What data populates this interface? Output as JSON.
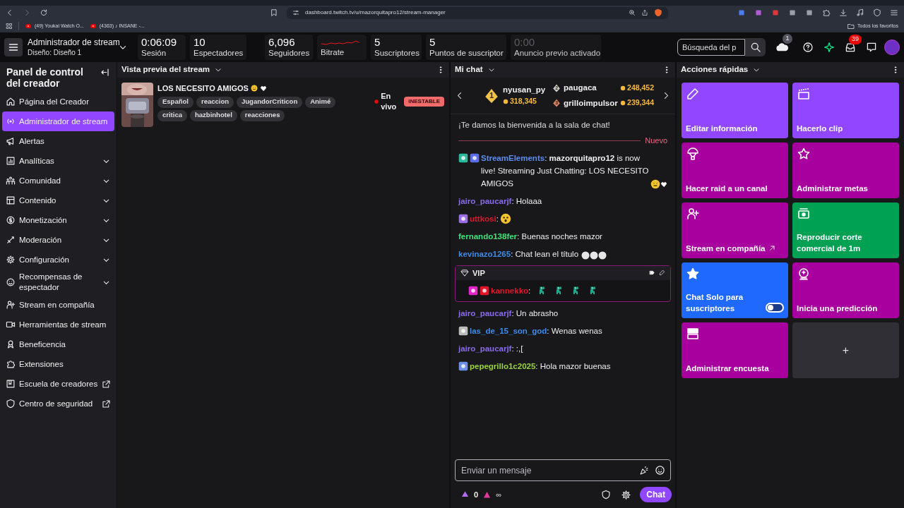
{
  "browser": {
    "url": "dashboard.twitch.tv/u/mazorquitapro12/stream-manager",
    "bookmarks": [
      "(49) Youkai Watch O...",
      "(4363) ♪ INSANE -..."
    ],
    "favorites": "Todos los favoritos"
  },
  "nav": {
    "title": "Administrador de stream",
    "subtitle": "Diseño: Diseño 1",
    "stats": [
      {
        "kind": "value",
        "value": "0:06:09",
        "label": "Sesión",
        "disabled": false
      },
      {
        "kind": "value",
        "value": "10",
        "label": "Espectadores",
        "disabled": false
      },
      {
        "kind": "value",
        "value": "6,096",
        "label": "Seguidores",
        "disabled": false
      },
      {
        "kind": "sparkline",
        "label": "Bitrate",
        "disabled": false
      },
      {
        "kind": "value",
        "value": "5",
        "label": "Suscriptores",
        "disabled": false
      },
      {
        "kind": "value",
        "value": "5",
        "label": "Puntos de suscriptor",
        "disabled": false
      },
      {
        "kind": "value",
        "value": "0:00",
        "label": "Anuncio previo activado",
        "disabled": true
      }
    ],
    "search_placeholder": "Búsqueda del p",
    "notifications_count": "1",
    "inbox_count": "39"
  },
  "sidebar": {
    "title": "Panel de control del creador",
    "items": [
      {
        "label": "Página del Creador",
        "selected": false,
        "has_submenu": false,
        "external": false
      },
      {
        "label": "Administrador de stream",
        "selected": true,
        "has_submenu": false,
        "external": false
      },
      {
        "label": "Alertas",
        "selected": false,
        "has_submenu": false,
        "external": false
      },
      {
        "label": "Analíticas",
        "selected": false,
        "has_submenu": true,
        "external": false
      },
      {
        "label": "Comunidad",
        "selected": false,
        "has_submenu": true,
        "external": false
      },
      {
        "label": "Contenido",
        "selected": false,
        "has_submenu": true,
        "external": false
      },
      {
        "label": "Monetización",
        "selected": false,
        "has_submenu": true,
        "external": false
      },
      {
        "label": "Moderación",
        "selected": false,
        "has_submenu": true,
        "external": false
      },
      {
        "label": "Configuración",
        "selected": false,
        "has_submenu": true,
        "external": false
      },
      {
        "label": "Recompensas de espectador",
        "selected": false,
        "has_submenu": true,
        "external": false
      },
      {
        "label": "Stream en compañía",
        "selected": false,
        "has_submenu": false,
        "external": false
      },
      {
        "label": "Herramientas de stream",
        "selected": false,
        "has_submenu": false,
        "external": false
      },
      {
        "label": "Beneficencia",
        "selected": false,
        "has_submenu": false,
        "external": false
      },
      {
        "label": "Extensiones",
        "selected": false,
        "has_submenu": false,
        "external": false
      },
      {
        "label": "Escuela de creadores",
        "selected": false,
        "has_submenu": false,
        "external": true
      },
      {
        "label": "Centro de seguridad",
        "selected": false,
        "has_submenu": false,
        "external": true
      }
    ]
  },
  "preview": {
    "header": "Vista previa del stream",
    "title": "LOS NECESITO AMIGOS",
    "tags": [
      "Español",
      "reaccion",
      "JugandorCriticon",
      "Animé",
      "critica",
      "hazbinhotel",
      "reacciones"
    ],
    "status": "En vivo",
    "health": "INESTABLE"
  },
  "chat": {
    "header": "Mi chat",
    "leaderboard": [
      {
        "rank": "1",
        "name": "nyusan_py",
        "points": "318,345"
      },
      {
        "rank": "2",
        "name": "paugaca",
        "points": "248,452"
      },
      {
        "rank": "3",
        "name": "grilloimpulsor",
        "points": "239,344"
      }
    ],
    "welcome": "¡Te damos la bienvenida a la sala de chat!",
    "divider": "Nuevo",
    "messages": [
      {
        "kind": "announce",
        "user": "StreamElements",
        "color": "#5b8def",
        "text": ": **mazorquitapro12** is now live! Streaming Just Chatting: LOS NECESITO AMIGOS"
      },
      {
        "kind": "plain",
        "user": "jairo_paucarjf",
        "color": "#8a6bf0",
        "text": ": Holaaa"
      },
      {
        "kind": "face_emote",
        "user": "uttkosi",
        "color": "#e0152b",
        "text": ":"
      },
      {
        "kind": "plain",
        "user": "fernando138fer",
        "color": "#3ee27a",
        "text": ": Buenas noches mazor"
      },
      {
        "kind": "dots_emote",
        "user": "kevinazo1265",
        "color": "#3d8be8",
        "text": ": Chat lean el título"
      },
      {
        "kind": "vip",
        "label": "VIP",
        "user": "kannekko",
        "color": "#e0152b",
        "text": ":"
      },
      {
        "kind": "plain",
        "user": "jairo_paucarjf",
        "color": "#8a6bf0",
        "text": ": Un abrasho"
      },
      {
        "kind": "plain",
        "user": "las_de_15_son_god",
        "color": "#3d8be8",
        "text": ": Wenas wenas"
      },
      {
        "kind": "plain",
        "user": "jairo_paucarjf",
        "color": "#8a6bf0",
        "text": ": :,["
      },
      {
        "kind": "plain",
        "user": "pepegrillo1c2025",
        "color": "#9ad23c",
        "text": ": Hola mazor buenas"
      }
    ],
    "input_placeholder": "Enviar un mensaje",
    "points": "0",
    "bits": "∞",
    "send_label": "Chat"
  },
  "actions": {
    "header": "Acciones rápidas",
    "tiles": [
      {
        "kind": "action",
        "label": "Editar información",
        "color": "#9147ff",
        "external": false
      },
      {
        "kind": "action",
        "label": "Hacerlo clip",
        "color": "#9147ff",
        "external": false
      },
      {
        "kind": "action",
        "label": "Hacer raid a un canal",
        "color": "#a8009e",
        "external": false
      },
      {
        "kind": "action",
        "label": "Administrar metas",
        "color": "#a8009e",
        "external": false
      },
      {
        "kind": "action",
        "label": "Stream en compañía",
        "color": "#a8009e",
        "external": true
      },
      {
        "kind": "action",
        "label": "Reproducir corte comercial de 1m",
        "color": "#00a152",
        "external": false
      },
      {
        "kind": "toggle",
        "label": "Chat Solo para suscriptores",
        "color": "#1f69ff",
        "external": false,
        "on": false
      },
      {
        "kind": "action",
        "label": "Inicia una predicción",
        "color": "#a8009e",
        "external": false
      },
      {
        "kind": "action",
        "label": "Administrar encuesta",
        "color": "#a8009e",
        "external": false
      },
      {
        "kind": "add",
        "label": "+",
        "color": "#2f2f35"
      }
    ]
  }
}
